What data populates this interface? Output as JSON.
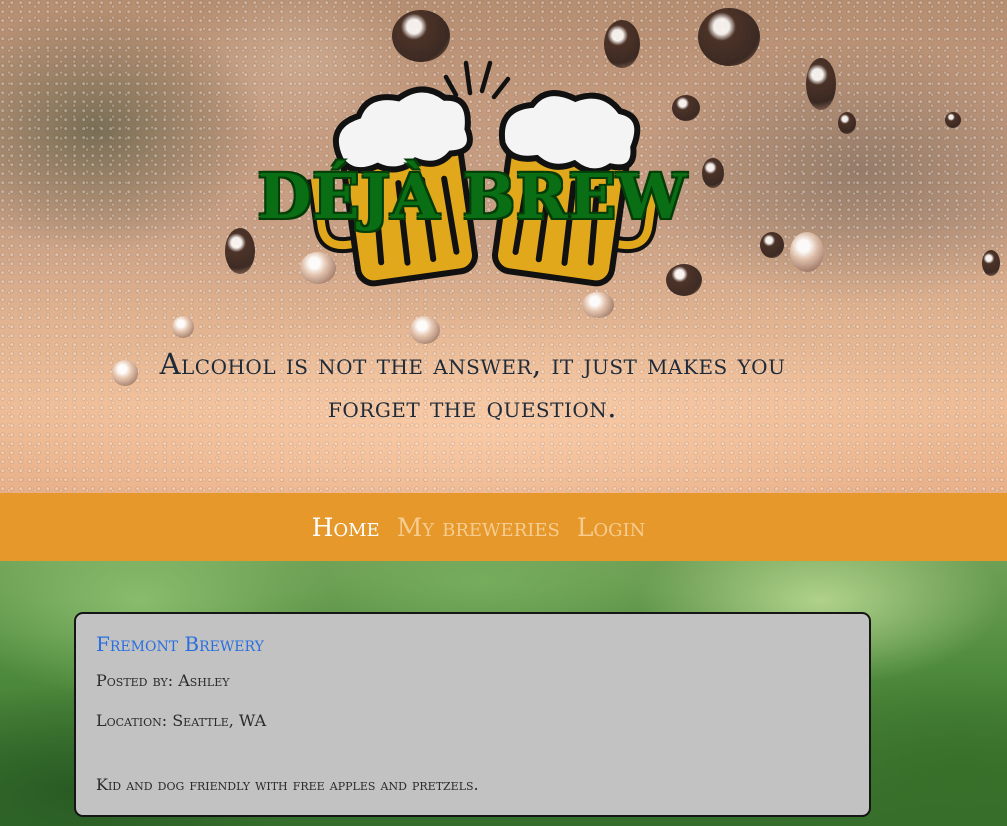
{
  "header": {
    "site_title": "Déjà Brew",
    "tagline": "Alcohol is not the answer, it just makes you forget the question."
  },
  "nav": {
    "items": [
      {
        "label": "Home",
        "active": true
      },
      {
        "label": "My breweries",
        "active": false
      },
      {
        "label": "Login",
        "active": false
      }
    ]
  },
  "posts": [
    {
      "title": "Fremont Brewery",
      "posted_by": "Posted by: Ashley",
      "location": "Location: Seattle, WA",
      "description": "Kid and dog friendly with free apples and pretzels."
    }
  ],
  "colors": {
    "nav_background": "#e6982b",
    "nav_active": "#ffffff",
    "nav_inactive": "#f6cc90",
    "title_green": "#0a6e14",
    "card_background": "#c2c2c2",
    "post_link": "#2a6fe0"
  },
  "icons": {
    "logo": "beer-mugs-cheers-icon"
  }
}
